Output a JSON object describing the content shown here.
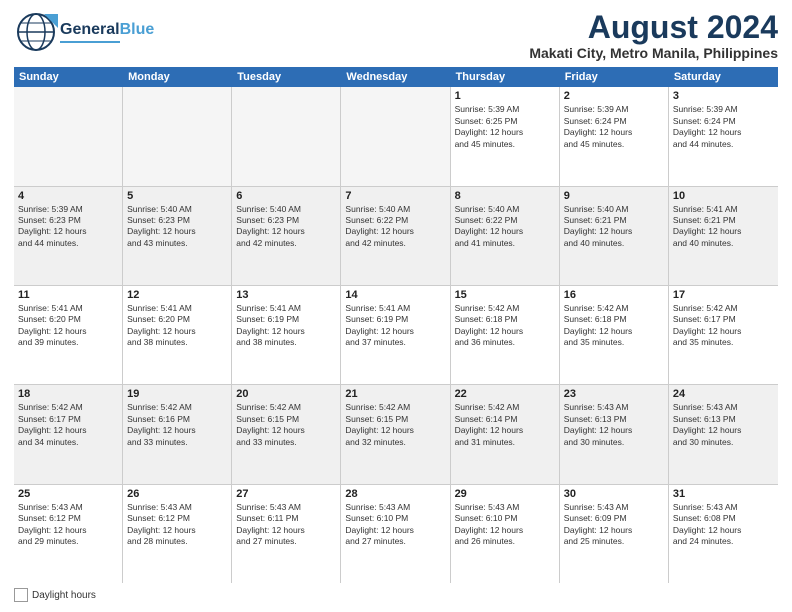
{
  "header": {
    "logo_general": "General",
    "logo_blue": "Blue",
    "main_title": "August 2024",
    "subtitle": "Makati City, Metro Manila, Philippines"
  },
  "calendar": {
    "days_of_week": [
      "Sunday",
      "Monday",
      "Tuesday",
      "Wednesday",
      "Thursday",
      "Friday",
      "Saturday"
    ],
    "weeks": [
      [
        {
          "day": "",
          "info": ""
        },
        {
          "day": "",
          "info": ""
        },
        {
          "day": "",
          "info": ""
        },
        {
          "day": "",
          "info": ""
        },
        {
          "day": "1",
          "info": "Sunrise: 5:39 AM\nSunset: 6:25 PM\nDaylight: 12 hours\nand 45 minutes."
        },
        {
          "day": "2",
          "info": "Sunrise: 5:39 AM\nSunset: 6:24 PM\nDaylight: 12 hours\nand 45 minutes."
        },
        {
          "day": "3",
          "info": "Sunrise: 5:39 AM\nSunset: 6:24 PM\nDaylight: 12 hours\nand 44 minutes."
        }
      ],
      [
        {
          "day": "4",
          "info": "Sunrise: 5:39 AM\nSunset: 6:23 PM\nDaylight: 12 hours\nand 44 minutes."
        },
        {
          "day": "5",
          "info": "Sunrise: 5:40 AM\nSunset: 6:23 PM\nDaylight: 12 hours\nand 43 minutes."
        },
        {
          "day": "6",
          "info": "Sunrise: 5:40 AM\nSunset: 6:23 PM\nDaylight: 12 hours\nand 42 minutes."
        },
        {
          "day": "7",
          "info": "Sunrise: 5:40 AM\nSunset: 6:22 PM\nDaylight: 12 hours\nand 42 minutes."
        },
        {
          "day": "8",
          "info": "Sunrise: 5:40 AM\nSunset: 6:22 PM\nDaylight: 12 hours\nand 41 minutes."
        },
        {
          "day": "9",
          "info": "Sunrise: 5:40 AM\nSunset: 6:21 PM\nDaylight: 12 hours\nand 40 minutes."
        },
        {
          "day": "10",
          "info": "Sunrise: 5:41 AM\nSunset: 6:21 PM\nDaylight: 12 hours\nand 40 minutes."
        }
      ],
      [
        {
          "day": "11",
          "info": "Sunrise: 5:41 AM\nSunset: 6:20 PM\nDaylight: 12 hours\nand 39 minutes."
        },
        {
          "day": "12",
          "info": "Sunrise: 5:41 AM\nSunset: 6:20 PM\nDaylight: 12 hours\nand 38 minutes."
        },
        {
          "day": "13",
          "info": "Sunrise: 5:41 AM\nSunset: 6:19 PM\nDaylight: 12 hours\nand 38 minutes."
        },
        {
          "day": "14",
          "info": "Sunrise: 5:41 AM\nSunset: 6:19 PM\nDaylight: 12 hours\nand 37 minutes."
        },
        {
          "day": "15",
          "info": "Sunrise: 5:42 AM\nSunset: 6:18 PM\nDaylight: 12 hours\nand 36 minutes."
        },
        {
          "day": "16",
          "info": "Sunrise: 5:42 AM\nSunset: 6:18 PM\nDaylight: 12 hours\nand 35 minutes."
        },
        {
          "day": "17",
          "info": "Sunrise: 5:42 AM\nSunset: 6:17 PM\nDaylight: 12 hours\nand 35 minutes."
        }
      ],
      [
        {
          "day": "18",
          "info": "Sunrise: 5:42 AM\nSunset: 6:17 PM\nDaylight: 12 hours\nand 34 minutes."
        },
        {
          "day": "19",
          "info": "Sunrise: 5:42 AM\nSunset: 6:16 PM\nDaylight: 12 hours\nand 33 minutes."
        },
        {
          "day": "20",
          "info": "Sunrise: 5:42 AM\nSunset: 6:15 PM\nDaylight: 12 hours\nand 33 minutes."
        },
        {
          "day": "21",
          "info": "Sunrise: 5:42 AM\nSunset: 6:15 PM\nDaylight: 12 hours\nand 32 minutes."
        },
        {
          "day": "22",
          "info": "Sunrise: 5:42 AM\nSunset: 6:14 PM\nDaylight: 12 hours\nand 31 minutes."
        },
        {
          "day": "23",
          "info": "Sunrise: 5:43 AM\nSunset: 6:13 PM\nDaylight: 12 hours\nand 30 minutes."
        },
        {
          "day": "24",
          "info": "Sunrise: 5:43 AM\nSunset: 6:13 PM\nDaylight: 12 hours\nand 30 minutes."
        }
      ],
      [
        {
          "day": "25",
          "info": "Sunrise: 5:43 AM\nSunset: 6:12 PM\nDaylight: 12 hours\nand 29 minutes."
        },
        {
          "day": "26",
          "info": "Sunrise: 5:43 AM\nSunset: 6:12 PM\nDaylight: 12 hours\nand 28 minutes."
        },
        {
          "day": "27",
          "info": "Sunrise: 5:43 AM\nSunset: 6:11 PM\nDaylight: 12 hours\nand 27 minutes."
        },
        {
          "day": "28",
          "info": "Sunrise: 5:43 AM\nSunset: 6:10 PM\nDaylight: 12 hours\nand 27 minutes."
        },
        {
          "day": "29",
          "info": "Sunrise: 5:43 AM\nSunset: 6:10 PM\nDaylight: 12 hours\nand 26 minutes."
        },
        {
          "day": "30",
          "info": "Sunrise: 5:43 AM\nSunset: 6:09 PM\nDaylight: 12 hours\nand 25 minutes."
        },
        {
          "day": "31",
          "info": "Sunrise: 5:43 AM\nSunset: 6:08 PM\nDaylight: 12 hours\nand 24 minutes."
        }
      ]
    ]
  },
  "legend": {
    "label": "Daylight hours"
  }
}
